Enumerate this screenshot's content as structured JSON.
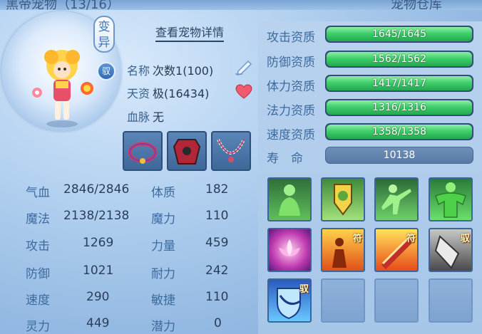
{
  "header": {
    "title_left": "黑帝宠物（13/16）",
    "title_right": "宠物仓库"
  },
  "pet": {
    "mutation_badge": "变异",
    "ride_badge": "驭",
    "view_detail": "查看宠物详情",
    "name_label": "名称",
    "name_value": "次数1(100)",
    "talent_label": "天资",
    "talent_value": "极(16434)",
    "bloodline_label": "血脉",
    "bloodline_value": "无"
  },
  "equipment": [
    {
      "name": "collar"
    },
    {
      "name": "armor"
    },
    {
      "name": "necklace"
    }
  ],
  "stats": [
    {
      "label": "气血",
      "value": "2846/2846",
      "label2": "体质",
      "value2": "182"
    },
    {
      "label": "魔法",
      "value": "2138/2138",
      "label2": "魔力",
      "value2": "110"
    },
    {
      "label": "攻击",
      "value": "1269",
      "label2": "力量",
      "value2": "459"
    },
    {
      "label": "防御",
      "value": "1021",
      "label2": "耐力",
      "value2": "242"
    },
    {
      "label": "速度",
      "value": "290",
      "label2": "敏捷",
      "value2": "110"
    },
    {
      "label": "灵力",
      "value": "449",
      "label2": "潜力",
      "value2": "0"
    }
  ],
  "aptitudes": [
    {
      "label": "攻击资质",
      "text": "1645/1645",
      "fill": 1.0
    },
    {
      "label": "防御资质",
      "text": "1562/1562",
      "fill": 1.0
    },
    {
      "label": "体力资质",
      "text": "1417/1417",
      "fill": 1.0
    },
    {
      "label": "法力资质",
      "text": "1316/1316",
      "fill": 1.0
    },
    {
      "label": "速度资质",
      "text": "1358/1358",
      "fill": 1.0
    }
  ],
  "lifespan": {
    "label": "寿　命",
    "value": "10138"
  },
  "skills": [
    {
      "icon": "green-figure-skill-icon",
      "tag": ""
    },
    {
      "icon": "shield-emblem-skill-icon",
      "tag": ""
    },
    {
      "icon": "green-kick-skill-icon",
      "tag": ""
    },
    {
      "icon": "green-muscle-skill-icon",
      "tag": ""
    },
    {
      "icon": "pink-lotus-skill-icon",
      "tag": ""
    },
    {
      "icon": "fire-figure-skill-icon",
      "tag": "符"
    },
    {
      "icon": "fire-blade-skill-icon",
      "tag": "符"
    },
    {
      "icon": "grey-blade-skill-icon",
      "tag": "驭"
    },
    {
      "icon": "blue-shield-skill-icon",
      "tag": "驭"
    },
    {
      "icon": "empty-slot",
      "tag": ""
    },
    {
      "icon": "empty-slot",
      "tag": ""
    },
    {
      "icon": "empty-slot",
      "tag": ""
    }
  ],
  "colors": {
    "bar_green": "#3fcf6b",
    "label_blue": "#3d6b9e",
    "panel_bg": "#a6c6e8"
  }
}
